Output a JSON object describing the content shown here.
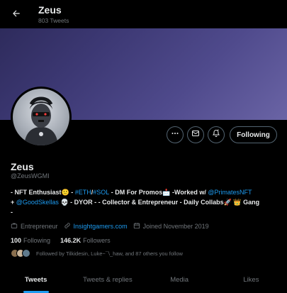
{
  "header": {
    "title": "Zeus",
    "tweet_count": "803 Tweets"
  },
  "profile": {
    "display_name": "Zeus",
    "handle": "@ZeusWGMI",
    "follow_label": "Following",
    "bio": {
      "s1": "- NFT Enthusiast",
      "s2": " - ",
      "eth": "#ETH",
      "slash": "/",
      "sol": "#SOL",
      "s3": " - DM For Promos",
      "s4": " -Worked w/ ",
      "primates": "@PrimatesNFT",
      "s5": "+ ",
      "goodskellas": "@GoodSkellas",
      "s6": " - DYOR - - Collector & Entrepreneur - Daily Collabs",
      "s7": " Gang",
      "s8": "-"
    },
    "profession": "Entrepreneur",
    "website": "Insightgamers.com",
    "joined": "Joined November 2019",
    "following_count": "100",
    "following_label": "Following",
    "followers_count": "146.2K",
    "followers_label": "Followers",
    "followed_by": "Followed by Tilkidesin, Luke~¯\\_haw, and 87 others you follow"
  },
  "tabs": [
    {
      "label": "Tweets",
      "active": true
    },
    {
      "label": "Tweets & replies",
      "active": false
    },
    {
      "label": "Media",
      "active": false
    },
    {
      "label": "Likes",
      "active": false
    }
  ],
  "colors": {
    "accent": "#1d9bf0",
    "banner": "#4f4a8c",
    "muted": "#71767b"
  },
  "icons": [
    "back-arrow-icon",
    "more-icon",
    "message-icon",
    "notification-bell-icon",
    "briefcase-icon",
    "link-icon",
    "calendar-icon"
  ]
}
